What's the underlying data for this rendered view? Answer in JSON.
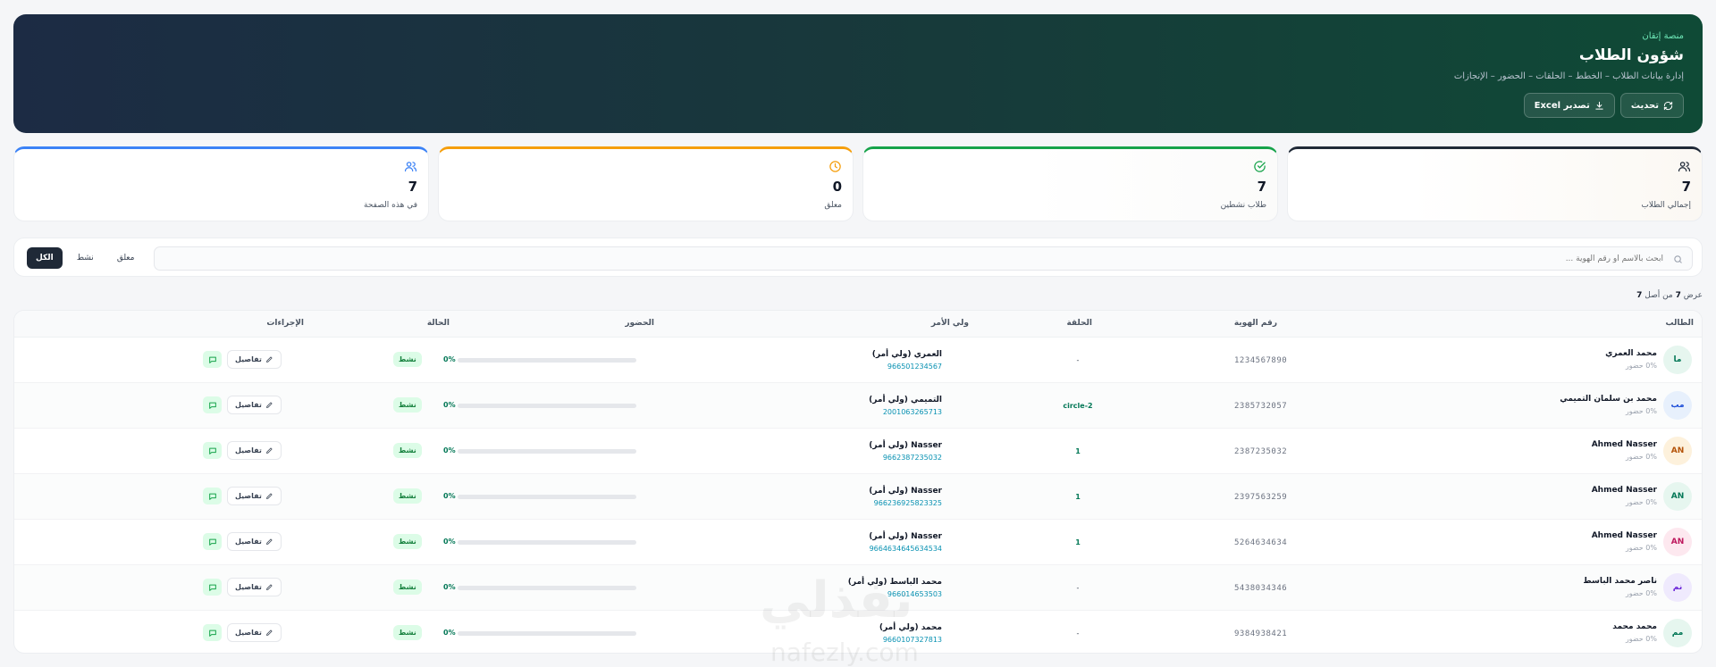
{
  "header": {
    "eyebrow": "منصة إتقان",
    "title": "شؤون الطلاب",
    "subtitle": "إدارة بيانات الطلاب – الخطط – الحلقات – الحضور – الإنجازات",
    "refresh_label": "تحديث",
    "export_label": "تصدير Excel"
  },
  "stats": [
    {
      "label": "إجمالي الطلاب",
      "value": "7",
      "icon": "users-icon",
      "color": "#1f2937"
    },
    {
      "label": "طلاب نشطين",
      "value": "7",
      "icon": "check-circle-icon",
      "color": "#16a34a"
    },
    {
      "label": "معلق",
      "value": "0",
      "icon": "clock-icon",
      "color": "#f59e0b"
    },
    {
      "label": "في هذه الصفحة",
      "value": "7",
      "icon": "users-icon",
      "color": "#3b82f6"
    }
  ],
  "search": {
    "placeholder": "ابحث بالاسم أو رقم الهوية ..."
  },
  "filters": {
    "all": "الكل",
    "active": "نشط",
    "suspended": "معلق"
  },
  "count": {
    "prefix": "عرض",
    "shown": "7",
    "middle": "من أصل",
    "total": "7"
  },
  "table": {
    "headers": {
      "student": "الطالب",
      "id": "رقم الهوية",
      "circle": "الحلقة",
      "guardian": "ولي الأمر",
      "attendance": "الحضور",
      "status": "الحالة",
      "actions": "الإجراءات"
    },
    "details_label": "تفاصيل",
    "rows": [
      {
        "initials": "ما",
        "name": "محمد العمري",
        "sub": "0% حضور",
        "id": "1234567890",
        "circle": "-",
        "guardian": "العمري (ولي أمر)",
        "phone": "966501234567",
        "attendance": "0%",
        "attendance_value": 0,
        "status": "نشط",
        "avatar_bg": "#e6f6ef",
        "avatar_fg": "#047857"
      },
      {
        "initials": "مب",
        "name": "محمد بن سلمان التميمي",
        "sub": "0% حضور",
        "id": "2385732057",
        "circle": "circle-2",
        "guardian": "التميمي (ولي أمر)",
        "phone": "2001063265713",
        "attendance": "0%",
        "attendance_value": 0,
        "status": "نشط",
        "avatar_bg": "#e7f0fc",
        "avatar_fg": "#1d4ed8"
      },
      {
        "initials": "AN",
        "name": "Ahmed Nasser",
        "sub": "0% حضور",
        "id": "2387235032",
        "circle": "1",
        "guardian": "Nasser (ولي أمر)",
        "phone": "9662387235032",
        "attendance": "0%",
        "attendance_value": 0,
        "status": "نشط",
        "avatar_bg": "#fdf1dc",
        "avatar_fg": "#b45309"
      },
      {
        "initials": "AN",
        "name": "Ahmed Nasser",
        "sub": "0% حضور",
        "id": "2397563259",
        "circle": "1",
        "guardian": "Nasser (ولي أمر)",
        "phone": "966236925823325",
        "attendance": "0%",
        "attendance_value": 0,
        "status": "نشط",
        "avatar_bg": "#e6f6ef",
        "avatar_fg": "#047857"
      },
      {
        "initials": "AN",
        "name": "Ahmed Nasser",
        "sub": "0% حضور",
        "id": "5264634634",
        "circle": "1",
        "guardian": "Nasser (ولي أمر)",
        "phone": "9664634645634534",
        "attendance": "0%",
        "attendance_value": 0,
        "status": "نشط",
        "avatar_bg": "#fde8ef",
        "avatar_fg": "#be185d"
      },
      {
        "initials": "نم",
        "name": "ناصر محمد الباسط",
        "sub": "0% حضور",
        "id": "5438034346",
        "circle": "-",
        "guardian": "محمد الباسط (ولي أمر)",
        "phone": "966014653503",
        "attendance": "0%",
        "attendance_value": 0,
        "status": "نشط",
        "avatar_bg": "#efeafd",
        "avatar_fg": "#6d28d9"
      },
      {
        "initials": "مم",
        "name": "محمد محمد",
        "sub": "0% حضور",
        "id": "9384938421",
        "circle": "-",
        "guardian": "محمد (ولي أمر)",
        "phone": "9660107327813",
        "attendance": "0%",
        "attendance_value": 0,
        "status": "نشط",
        "avatar_bg": "#e6f6ef",
        "avatar_fg": "#047857"
      }
    ]
  },
  "watermark": {
    "brand": "نفذلي",
    "domain": "nafezly.com"
  }
}
